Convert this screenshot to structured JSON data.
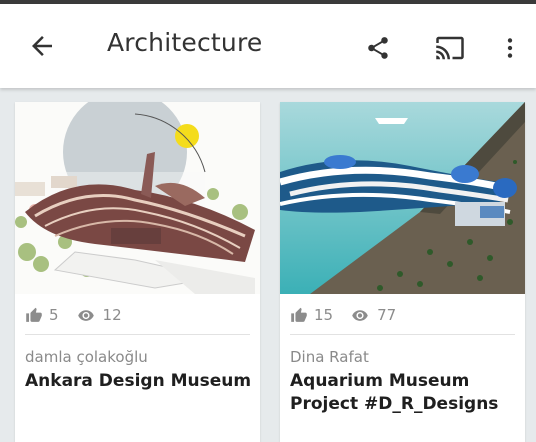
{
  "header": {
    "title": "Architecture",
    "back_icon": "arrow-back-icon",
    "share_icon": "share-icon",
    "cast_icon": "cast-icon",
    "more_icon": "more-vert-icon"
  },
  "projects": [
    {
      "likes": "5",
      "views": "12",
      "author": "damla çolakoğlu",
      "title": "Ankara Design Museum"
    },
    {
      "likes": "15",
      "views": "77",
      "author": "Dina Rafat",
      "title": "Aquarium Museum Project #D_R_Designs"
    }
  ],
  "colors": {
    "appbar": "#ffffff",
    "background": "#e6eaec",
    "icon": "#333333",
    "meta_text": "#8c8c8c"
  }
}
